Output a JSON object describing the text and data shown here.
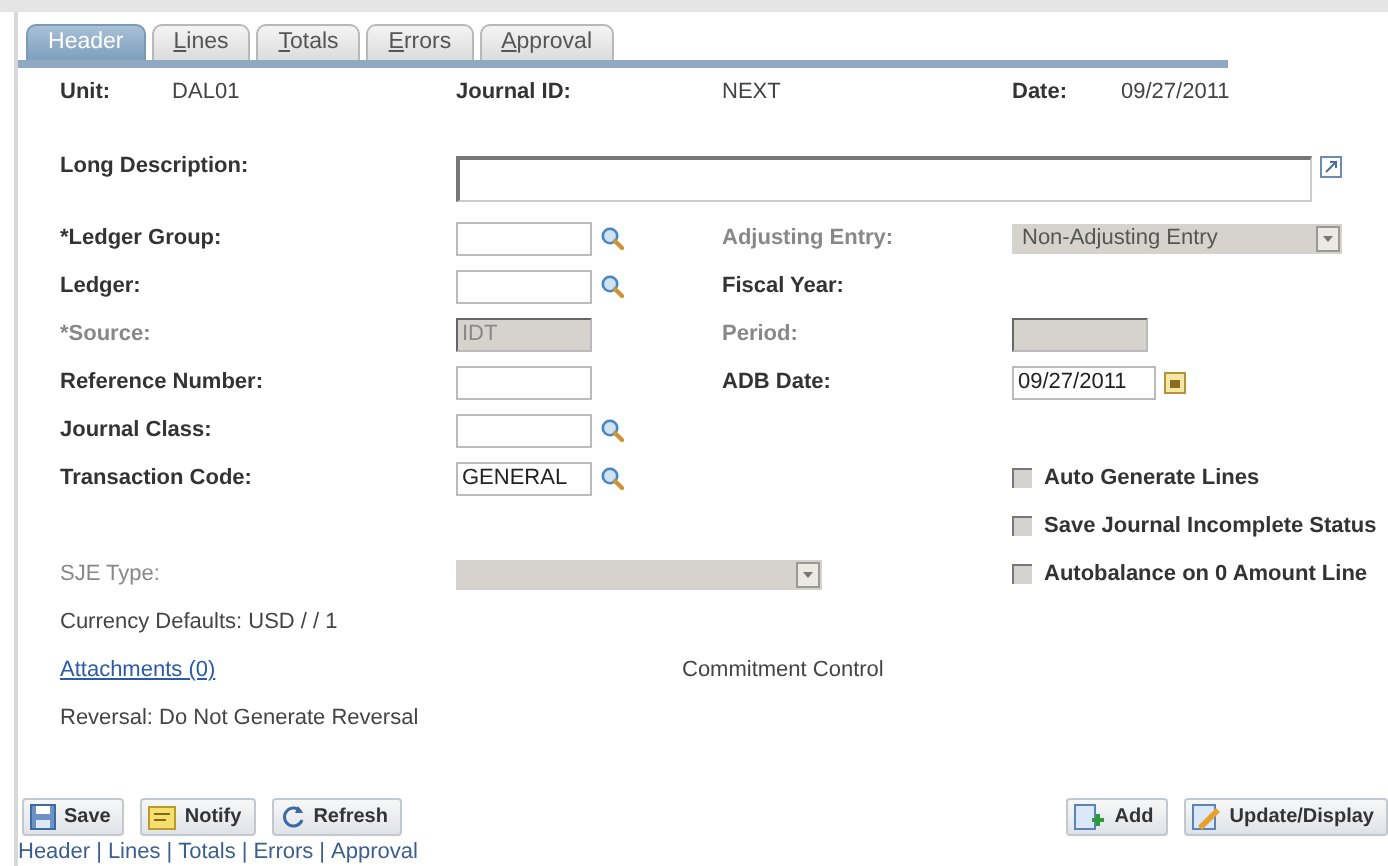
{
  "tabs": [
    {
      "label": "Header",
      "selected": true,
      "underline_first": false
    },
    {
      "label": "Lines",
      "selected": false,
      "underline_first": true
    },
    {
      "label": "Totals",
      "selected": false,
      "underline_first": true
    },
    {
      "label": "Errors",
      "selected": false,
      "underline_first": true
    },
    {
      "label": "Approval",
      "selected": false,
      "underline_first": true
    }
  ],
  "summary": [
    {
      "label": "Unit:",
      "value": "DAL01"
    },
    {
      "label": "Journal ID:",
      "value": "NEXT"
    },
    {
      "label": "Date:",
      "value": "09/27/2011"
    }
  ],
  "long_description": {
    "label": "Long Description:"
  },
  "rows": [
    {
      "left": {
        "label": "*Ledger Group:",
        "disabled": false,
        "kind": "lookup"
      },
      "right": {
        "label": "Adjusting Entry:",
        "disabled": true,
        "kind": "select",
        "value": "Non-Adjusting Entry"
      }
    },
    {
      "left": {
        "label": "Ledger:",
        "disabled": false,
        "kind": "lookup"
      },
      "right": {
        "label": "Fiscal Year:",
        "disabled": false,
        "kind": "none"
      }
    },
    {
      "left": {
        "label": "*Source:",
        "disabled": true,
        "kind": "text",
        "value": "IDT"
      },
      "right": {
        "label": "Period:",
        "disabled": true,
        "kind": "text"
      }
    },
    {
      "left": {
        "label": "Reference Number:",
        "disabled": false,
        "kind": "text"
      },
      "right": {
        "label": "ADB Date:",
        "disabled": false,
        "kind": "date",
        "value": "09/27/2011"
      }
    },
    {
      "left": {
        "label": "Journal Class:",
        "disabled": false,
        "kind": "lookup"
      }
    },
    {
      "left": {
        "label": "Transaction Code:",
        "disabled": false,
        "kind": "lookup",
        "value": "GENERAL"
      },
      "check": {
        "label": "Auto Generate Lines",
        "checked": false
      }
    },
    {
      "check": {
        "label": "Save Journal Incomplete Status",
        "checked": false
      }
    },
    {
      "left": {
        "label": "SJE Type:",
        "disabled": true,
        "kind": "wide_select"
      },
      "check": {
        "label": "Autobalance on 0 Amount Line",
        "checked": false
      }
    }
  ],
  "currency_defaults": "Currency Defaults: USD / / 1",
  "attachments_link": "Attachments (0)",
  "commitment_control": "Commitment Control",
  "reversal": "Reversal: Do Not Generate Reversal",
  "left_buttons": [
    "Save",
    "Notify",
    "Refresh"
  ],
  "right_buttons": [
    "Add",
    "Update/Display"
  ],
  "footer_links": [
    "Header",
    "Lines",
    "Totals",
    "Errors",
    "Approval"
  ],
  "footer_separator": "|"
}
